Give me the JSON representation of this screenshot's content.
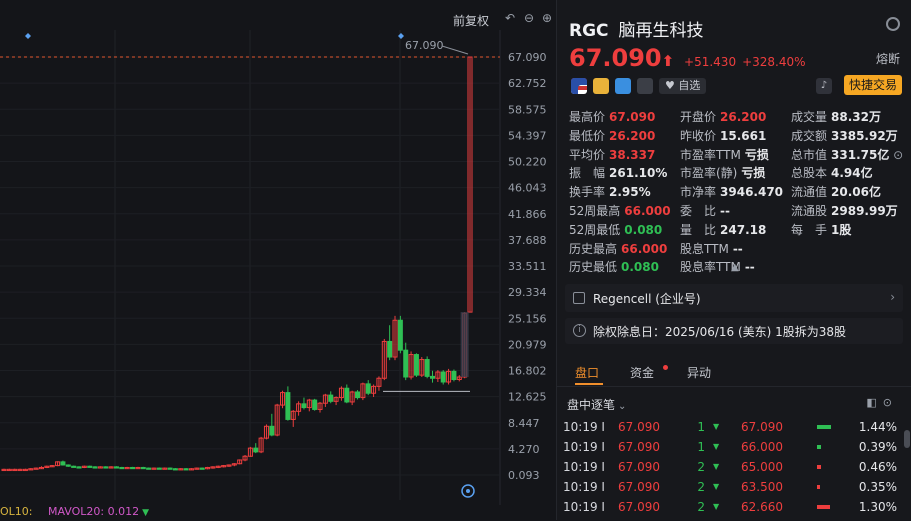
{
  "chart": {
    "title": "前复权",
    "tools": [
      "undo-icon",
      "zoom-out-icon",
      "zoom-in-icon"
    ],
    "price_axis": [
      "67.090",
      "62.752",
      "58.575",
      "54.397",
      "50.220",
      "46.043",
      "41.866",
      "37.688",
      "33.511",
      "29.334",
      "25.156",
      "20.979",
      "16.802",
      "12.625",
      "8.447",
      "4.270",
      "0.093"
    ],
    "current_price_label": "67.090",
    "high_annotation": "67.090",
    "colors": {
      "up": "#ee3e3e",
      "down": "#2fbf54",
      "dash": "#e2562f"
    },
    "legend": {
      "vol10": "OL10:",
      "mavol20": "MAVOL20: 0.012"
    }
  },
  "chart_data": {
    "type": "candlestick",
    "ylim": [
      0.093,
      67.09
    ],
    "candles": [
      [
        1.0,
        1.1,
        0.9,
        1.0
      ],
      [
        1.0,
        1.1,
        0.9,
        1.0
      ],
      [
        1.0,
        1.1,
        0.9,
        1.0
      ],
      [
        1.0,
        1.1,
        0.9,
        1.0
      ],
      [
        1.0,
        1.1,
        0.9,
        1.0
      ],
      [
        1.0,
        1.2,
        0.9,
        1.1
      ],
      [
        1.1,
        1.3,
        1.0,
        1.2
      ],
      [
        1.2,
        1.5,
        1.1,
        1.3
      ],
      [
        1.3,
        1.6,
        1.2,
        1.5
      ],
      [
        1.5,
        1.7,
        1.4,
        1.6
      ],
      [
        1.6,
        2.3,
        1.5,
        2.2
      ],
      [
        2.2,
        2.4,
        1.6,
        1.7
      ],
      [
        1.7,
        1.8,
        1.4,
        1.5
      ],
      [
        1.5,
        1.6,
        1.3,
        1.4
      ],
      [
        1.4,
        1.5,
        1.2,
        1.3
      ],
      [
        1.3,
        1.6,
        1.2,
        1.5
      ],
      [
        1.5,
        1.6,
        1.3,
        1.4
      ],
      [
        1.4,
        1.5,
        1.2,
        1.3
      ],
      [
        1.3,
        1.5,
        1.2,
        1.4
      ],
      [
        1.4,
        1.5,
        1.2,
        1.3
      ],
      [
        1.3,
        1.5,
        1.2,
        1.4
      ],
      [
        1.4,
        1.5,
        1.2,
        1.3
      ],
      [
        1.3,
        1.4,
        1.1,
        1.2
      ],
      [
        1.2,
        1.4,
        1.1,
        1.3
      ],
      [
        1.3,
        1.4,
        1.1,
        1.2
      ],
      [
        1.2,
        1.4,
        1.1,
        1.3
      ],
      [
        1.3,
        1.4,
        1.1,
        1.2
      ],
      [
        1.2,
        1.3,
        1.0,
        1.1
      ],
      [
        1.1,
        1.3,
        1.0,
        1.2
      ],
      [
        1.2,
        1.3,
        1.0,
        1.1
      ],
      [
        1.1,
        1.3,
        1.0,
        1.2
      ],
      [
        1.2,
        1.3,
        1.0,
        1.1
      ],
      [
        1.1,
        1.2,
        0.9,
        1.0
      ],
      [
        1.0,
        1.2,
        0.9,
        1.1
      ],
      [
        1.1,
        1.2,
        0.9,
        1.0
      ],
      [
        1.0,
        1.2,
        0.9,
        1.1
      ],
      [
        1.1,
        1.3,
        1.0,
        1.2
      ],
      [
        1.2,
        1.3,
        1.0,
        1.1
      ],
      [
        1.1,
        1.4,
        1.0,
        1.3
      ],
      [
        1.3,
        1.5,
        1.1,
        1.4
      ],
      [
        1.4,
        1.6,
        1.2,
        1.5
      ],
      [
        1.5,
        1.7,
        1.3,
        1.6
      ],
      [
        1.6,
        1.8,
        1.4,
        1.7
      ],
      [
        1.7,
        2.0,
        1.5,
        1.9
      ],
      [
        1.9,
        2.6,
        1.8,
        2.5
      ],
      [
        2.5,
        3.3,
        2.3,
        3.1
      ],
      [
        3.1,
        4.6,
        3.0,
        4.4
      ],
      [
        4.4,
        5.2,
        3.6,
        3.8
      ],
      [
        3.8,
        6.2,
        3.6,
        6.0
      ],
      [
        6.0,
        8.2,
        5.8,
        7.9
      ],
      [
        7.9,
        9.9,
        6.3,
        6.5
      ],
      [
        6.5,
        11.5,
        6.3,
        11.3
      ],
      [
        11.3,
        13.6,
        10.8,
        13.3
      ],
      [
        13.3,
        14.3,
        8.8,
        9.0
      ],
      [
        9.0,
        10.5,
        7.8,
        10.3
      ],
      [
        10.3,
        11.9,
        9.6,
        11.5
      ],
      [
        11.5,
        12.5,
        10.6,
        10.9
      ],
      [
        10.9,
        12.3,
        10.3,
        12.1
      ],
      [
        12.1,
        12.3,
        10.4,
        10.6
      ],
      [
        10.6,
        11.8,
        10.1,
        11.6
      ],
      [
        11.6,
        13.1,
        11.0,
        12.9
      ],
      [
        12.9,
        13.5,
        11.6,
        11.9
      ],
      [
        11.9,
        12.7,
        11.3,
        12.5
      ],
      [
        12.5,
        14.3,
        12.0,
        14.0
      ],
      [
        14.0,
        14.6,
        11.6,
        11.8
      ],
      [
        11.8,
        13.6,
        11.3,
        13.4
      ],
      [
        13.4,
        13.7,
        12.2,
        12.5
      ],
      [
        12.5,
        14.9,
        12.1,
        14.7
      ],
      [
        14.7,
        15.3,
        12.9,
        13.2
      ],
      [
        13.2,
        14.6,
        12.6,
        14.3
      ],
      [
        14.3,
        15.9,
        13.6,
        15.6
      ],
      [
        15.6,
        21.9,
        15.3,
        21.5
      ],
      [
        21.5,
        24.1,
        18.5,
        19.0
      ],
      [
        19.0,
        25.6,
        18.5,
        24.9
      ],
      [
        24.9,
        25.6,
        19.6,
        20.1
      ],
      [
        20.1,
        21.3,
        15.3,
        15.8
      ],
      [
        15.8,
        19.9,
        15.4,
        19.4
      ],
      [
        19.4,
        19.6,
        15.8,
        16.1
      ],
      [
        16.1,
        19.0,
        15.8,
        18.6
      ],
      [
        18.6,
        19.1,
        15.6,
        15.9
      ],
      [
        15.9,
        16.8,
        14.9,
        15.6
      ],
      [
        15.6,
        16.9,
        15.0,
        16.6
      ],
      [
        16.6,
        16.9,
        14.6,
        15.0
      ],
      [
        15.0,
        17.1,
        14.6,
        16.7
      ],
      [
        16.7,
        17.0,
        15.1,
        15.4
      ],
      [
        15.4,
        16.1,
        15.1,
        15.8
      ],
      [
        15.8,
        26.2,
        15.6,
        26.0
      ],
      [
        26.2,
        67.09,
        26.2,
        67.09
      ]
    ]
  },
  "header": {
    "ticker": "RGC",
    "name": "脑再生科技",
    "price": "67.090",
    "arrow": "⬆",
    "change": "+51.430",
    "change_pct": "+328.40%",
    "status": "熔断",
    "fav_label": "自选",
    "trade_button": "快捷交易"
  },
  "stats": [
    {
      "label": "最高价",
      "value": "67.090",
      "color": "red"
    },
    {
      "label": "开盘价",
      "value": "26.200",
      "color": "red"
    },
    {
      "label": "成交量",
      "value": "88.32万",
      "color": ""
    },
    {
      "label": "最低价",
      "value": "26.200",
      "color": "red"
    },
    {
      "label": "昨收价",
      "value": "15.661",
      "color": ""
    },
    {
      "label": "成交额",
      "value": "3385.92万",
      "color": ""
    },
    {
      "label": "平均价",
      "value": "38.337",
      "color": "red"
    },
    {
      "label": "市盈率TTM",
      "value": "亏损",
      "color": ""
    },
    {
      "label": "总市值",
      "value": "331.75亿",
      "color": ""
    },
    {
      "label": "振　幅",
      "value": "261.10%",
      "color": ""
    },
    {
      "label": "市盈率(静)",
      "value": "亏损",
      "color": ""
    },
    {
      "label": "总股本",
      "value": "4.94亿",
      "color": ""
    },
    {
      "label": "换手率",
      "value": "2.95%",
      "color": ""
    },
    {
      "label": "市净率",
      "value": "3946.470",
      "color": ""
    },
    {
      "label": "流通值",
      "value": "20.06亿",
      "color": ""
    },
    {
      "label": "52周最高",
      "value": "66.000",
      "color": "red"
    },
    {
      "label": "委　比",
      "value": "--",
      "color": ""
    },
    {
      "label": "流通股",
      "value": "2989.99万",
      "color": ""
    },
    {
      "label": "52周最低",
      "value": "0.080",
      "color": "green"
    },
    {
      "label": "量　比",
      "value": "247.18",
      "color": ""
    },
    {
      "label": "每　手",
      "value": "1股",
      "color": ""
    },
    {
      "label": "历史最高",
      "value": "66.000",
      "color": "red"
    },
    {
      "label": "股息TTM",
      "value": "--",
      "color": ""
    },
    {
      "label": "",
      "value": "",
      "color": ""
    },
    {
      "label": "历史最低",
      "value": "0.080",
      "color": "green"
    },
    {
      "label": "股息率TTM",
      "value": "--",
      "color": ""
    }
  ],
  "company": {
    "label": "Regencell (企业号)"
  },
  "notice": {
    "text": "除权除息日：2025/06/16 (美东) 1股拆为38股"
  },
  "tabs": [
    "盘口",
    "资金",
    "异动"
  ],
  "ticks": {
    "title": "盘中逐笔",
    "rows": [
      {
        "time": "10:19",
        "sep": "I",
        "price": "67.090",
        "vol": "1"
      },
      {
        "time": "10:19",
        "sep": "I",
        "price": "67.090",
        "vol": "1"
      },
      {
        "time": "10:19",
        "sep": "I",
        "price": "67.090",
        "vol": "2"
      },
      {
        "time": "10:19",
        "sep": "I",
        "price": "67.090",
        "vol": "2"
      },
      {
        "time": "10:19",
        "sep": "I",
        "price": "67.090",
        "vol": "2"
      }
    ]
  },
  "distribution": [
    {
      "price": "67.090",
      "pct": "1.44%",
      "share": 1.44,
      "color": "green"
    },
    {
      "price": "66.000",
      "pct": "0.39%",
      "share": 0.39,
      "color": "green"
    },
    {
      "price": "65.000",
      "pct": "0.46%",
      "share": 0.46,
      "color": "red"
    },
    {
      "price": "63.500",
      "pct": "0.35%",
      "share": 0.35,
      "color": "red"
    },
    {
      "price": "62.660",
      "pct": "1.30%",
      "share": 1.3,
      "color": "red"
    }
  ]
}
